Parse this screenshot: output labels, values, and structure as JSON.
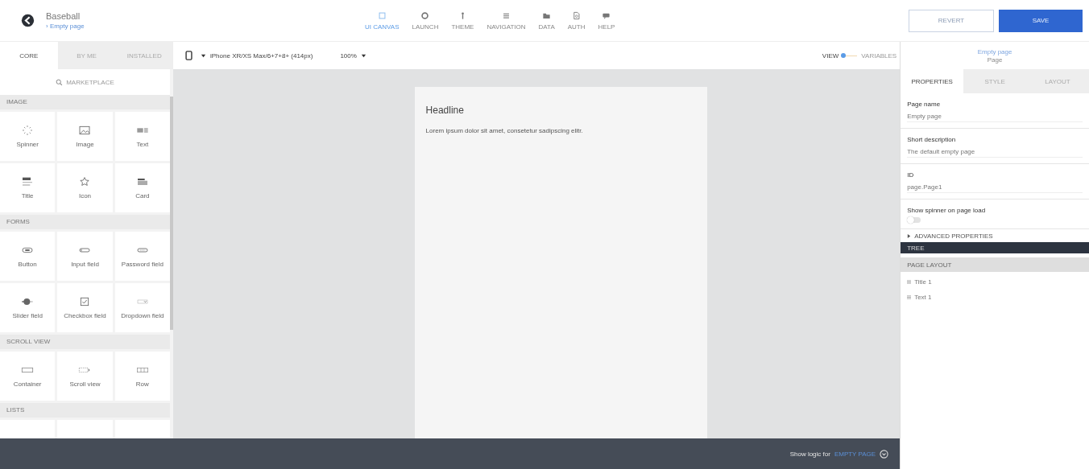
{
  "app": {
    "title": "Baseball",
    "breadcrumb": "› Empty page"
  },
  "nav": [
    {
      "label": "UI CANVAS",
      "selected": true
    },
    {
      "label": "LAUNCH",
      "selected": false
    },
    {
      "label": "THEME",
      "selected": false
    },
    {
      "label": "NAVIGATION",
      "selected": false
    },
    {
      "label": "DATA",
      "selected": false
    },
    {
      "label": "AUTH",
      "selected": false
    },
    {
      "label": "HELP",
      "selected": false
    }
  ],
  "actions": {
    "revert": "REVERT",
    "save": "SAVE"
  },
  "palette_tabs": [
    {
      "label": "CORE",
      "selected": true
    },
    {
      "label": "BY ME",
      "selected": false
    },
    {
      "label": "INSTALLED",
      "selected": false
    }
  ],
  "marketplace": "MARKETPLACE",
  "sections": [
    {
      "title": "IMAGE",
      "items": [
        "Spinner",
        "Image",
        "Text",
        "Title",
        "Icon",
        "Card"
      ]
    },
    {
      "title": "FORMS",
      "items": [
        "Button",
        "Input field",
        "Password field",
        "Slider field",
        "Checkbox field",
        "Dropdown field"
      ]
    },
    {
      "title": "SCROLL VIEW",
      "items": [
        "Container",
        "Scroll view",
        "Row"
      ]
    },
    {
      "title": "LISTS"
    }
  ],
  "device": "iPhone XR/XS Max/6+7+8+ (414px)",
  "zoom": "100%",
  "view_switch": [
    {
      "label": "VIEW",
      "selected": true
    },
    {
      "label": "VARIABLES",
      "selected": false
    }
  ],
  "canvas": {
    "headline": "Headline",
    "text": "Lorem ipsum dolor sit amet, consetetur sadipscing elitr."
  },
  "logic_bar": {
    "label": "Show logic for",
    "link": "EMPTY PAGE"
  },
  "inspector": {
    "name": "Empty page",
    "type": "Page",
    "tabs": [
      {
        "label": "PROPERTIES",
        "selected": true
      },
      {
        "label": "STYLE",
        "selected": false
      },
      {
        "label": "LAYOUT",
        "selected": false
      }
    ],
    "fields": [
      {
        "label": "Page name",
        "value": "Empty page"
      },
      {
        "label": "Short description",
        "value": "The default empty page"
      },
      {
        "label": "ID",
        "value": "page.Page1"
      }
    ],
    "spinner": {
      "label": "Show spinner on page load",
      "on": false
    },
    "advanced": "ADVANCED PROPERTIES"
  },
  "tree": {
    "title": "TREE",
    "header": "PAGE LAYOUT",
    "items": [
      "Title 1",
      "Text 1"
    ]
  }
}
